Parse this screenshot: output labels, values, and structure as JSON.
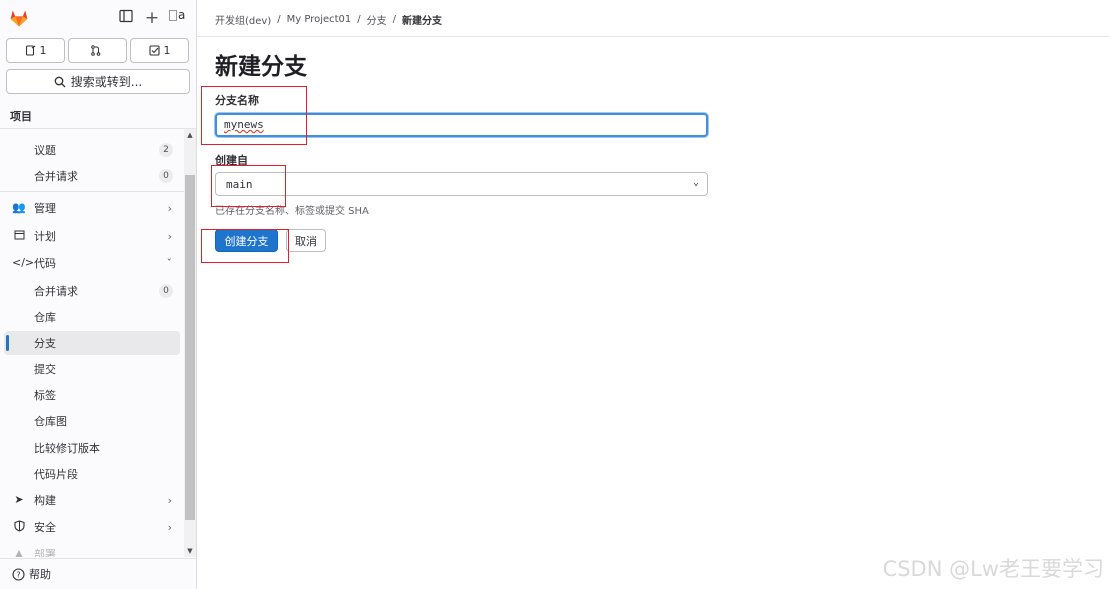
{
  "sidebar": {
    "top_icons": [
      "gitlab-logo",
      "sidebar-toggle-icon",
      "plus-icon",
      "avatar"
    ],
    "avatar_alt": "a",
    "counts": [
      {
        "icon": "issues-icon",
        "value": "1"
      },
      {
        "icon": "merge-request-icon",
        "value": ""
      },
      {
        "icon": "todo-icon",
        "value": "1"
      }
    ],
    "search_label": "搜索或转到...",
    "section_title": "项目",
    "items": {
      "issues": {
        "label": "议题",
        "badge": "2"
      },
      "merge_requests": {
        "label": "合并请求",
        "badge": "0"
      },
      "manage": {
        "label": "管理"
      },
      "plan": {
        "label": "计划"
      },
      "code": {
        "label": "代码"
      },
      "code_mr": {
        "label": "合并请求",
        "badge": "0"
      },
      "repository": {
        "label": "仓库"
      },
      "branches": {
        "label": "分支"
      },
      "commits": {
        "label": "提交"
      },
      "tags": {
        "label": "标签"
      },
      "graph": {
        "label": "仓库图"
      },
      "compare": {
        "label": "比较修订版本"
      },
      "snippets": {
        "label": "代码片段"
      },
      "build": {
        "label": "构建"
      },
      "secure": {
        "label": "安全"
      },
      "deploy": {
        "label": "部署"
      }
    },
    "help_label": "帮助"
  },
  "breadcrumb": {
    "group": "开发组(dev)",
    "project": "My Project01",
    "branches": "分支",
    "current": "新建分支",
    "separator": "/"
  },
  "main": {
    "title": "新建分支",
    "branch_name_label": "分支名称",
    "branch_name_value": "mynews",
    "create_from_label": "创建自",
    "create_from_value": "main",
    "help_text": "已存在分支名称、标签或提交 SHA",
    "create_button": "创建分支",
    "cancel_button": "取消"
  },
  "watermark": "CSDN @Lw老王要学习",
  "colors": {
    "primary": "#1f75cb",
    "annotation": "#e0202a",
    "focus": "#428fdc"
  }
}
